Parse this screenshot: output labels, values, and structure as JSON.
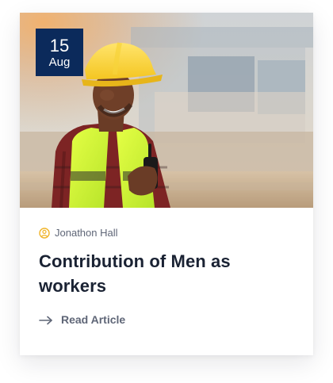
{
  "card": {
    "date": {
      "day": "15",
      "month": "Aug"
    },
    "author": {
      "name": "Jonathon Hall",
      "icon": "user-circle-icon"
    },
    "title": "Contribution of Men as workers",
    "read_more": {
      "label": "Read Article",
      "icon": "arrow-right-icon"
    },
    "colors": {
      "badge_bg": "#0b2a5b",
      "author_icon": "#f0b429",
      "text_dark": "#1a2233",
      "text_muted": "#5f6677"
    }
  }
}
